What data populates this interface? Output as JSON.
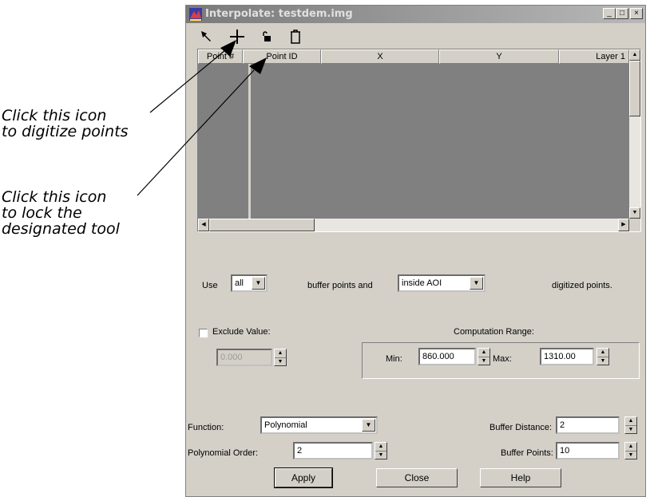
{
  "window": {
    "title": "Interpolate: testdem.img"
  },
  "title_buttons": {
    "minimize": "_",
    "maximize": "□",
    "close": "×"
  },
  "toolbar": {
    "icons": [
      "select-arrow-icon",
      "digitize-crosshair-icon",
      "lock-icon",
      "delete-icon"
    ]
  },
  "table": {
    "columns": [
      "Point #",
      "Point ID",
      "X",
      "Y",
      "Layer 1"
    ]
  },
  "use_row": {
    "use_label": "Use",
    "use_value": "all",
    "buffer_label": "buffer points and",
    "aoi_value": "inside AOI",
    "digitized_label": "digitized points."
  },
  "exclude": {
    "label": "Exclude Value:",
    "value": "0.000",
    "checked": false
  },
  "range": {
    "title": "Computation Range:",
    "min_label": "Min:",
    "min_value": "860.000",
    "max_label": "Max:",
    "max_value": "1310.00"
  },
  "function": {
    "label": "Function:",
    "value": "Polynomial"
  },
  "order": {
    "label": "Polynomial Order:",
    "value": "2"
  },
  "buffer_distance": {
    "label": "Buffer Distance:",
    "value": "2"
  },
  "buffer_points": {
    "label": "Buffer Points:",
    "value": "10"
  },
  "buttons": {
    "apply": "Apply",
    "close": "Close",
    "help": "Help"
  },
  "callouts": {
    "digitize": [
      "Click this icon",
      "to digitize points"
    ],
    "lock": [
      "Click this icon",
      "to lock the",
      "designated tool"
    ]
  }
}
